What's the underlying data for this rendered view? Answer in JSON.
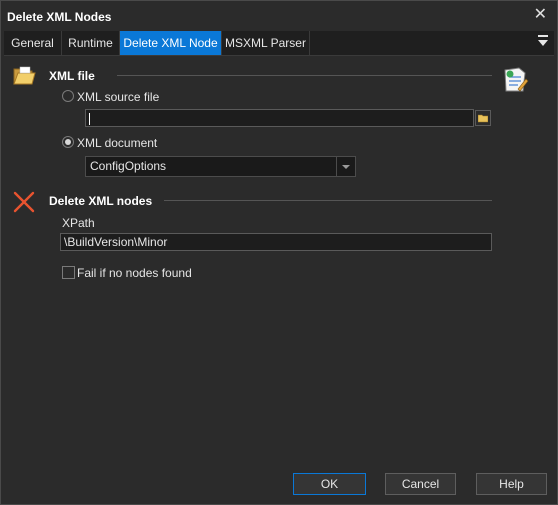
{
  "window": {
    "title": "Delete XML Nodes",
    "close_glyph": "✕"
  },
  "tabs": [
    {
      "label": "General"
    },
    {
      "label": "Runtime"
    },
    {
      "label": "Delete XML Node",
      "active": true
    },
    {
      "label": "MSXML Parser"
    }
  ],
  "xml_file": {
    "title": "XML file",
    "icon": "folder-open-icon",
    "right_icon": "xml-document-icon",
    "source_file": {
      "label": "XML source file",
      "checked": false,
      "value": ""
    },
    "document": {
      "label": "XML document",
      "checked": true,
      "selected": "ConfigOptions"
    }
  },
  "delete_nodes": {
    "title": "Delete XML nodes",
    "icon": "red-x-icon",
    "xpath": {
      "label": "XPath",
      "value": "\\BuildVersion\\Minor"
    },
    "fail_if_none": {
      "label": "Fail if no nodes found",
      "checked": false
    }
  },
  "buttons": {
    "ok": "OK",
    "cancel": "Cancel",
    "help": "Help"
  },
  "colors": {
    "accent": "#0a78d7",
    "background": "#2b2b2b",
    "delete_icon": "#e8532f"
  }
}
